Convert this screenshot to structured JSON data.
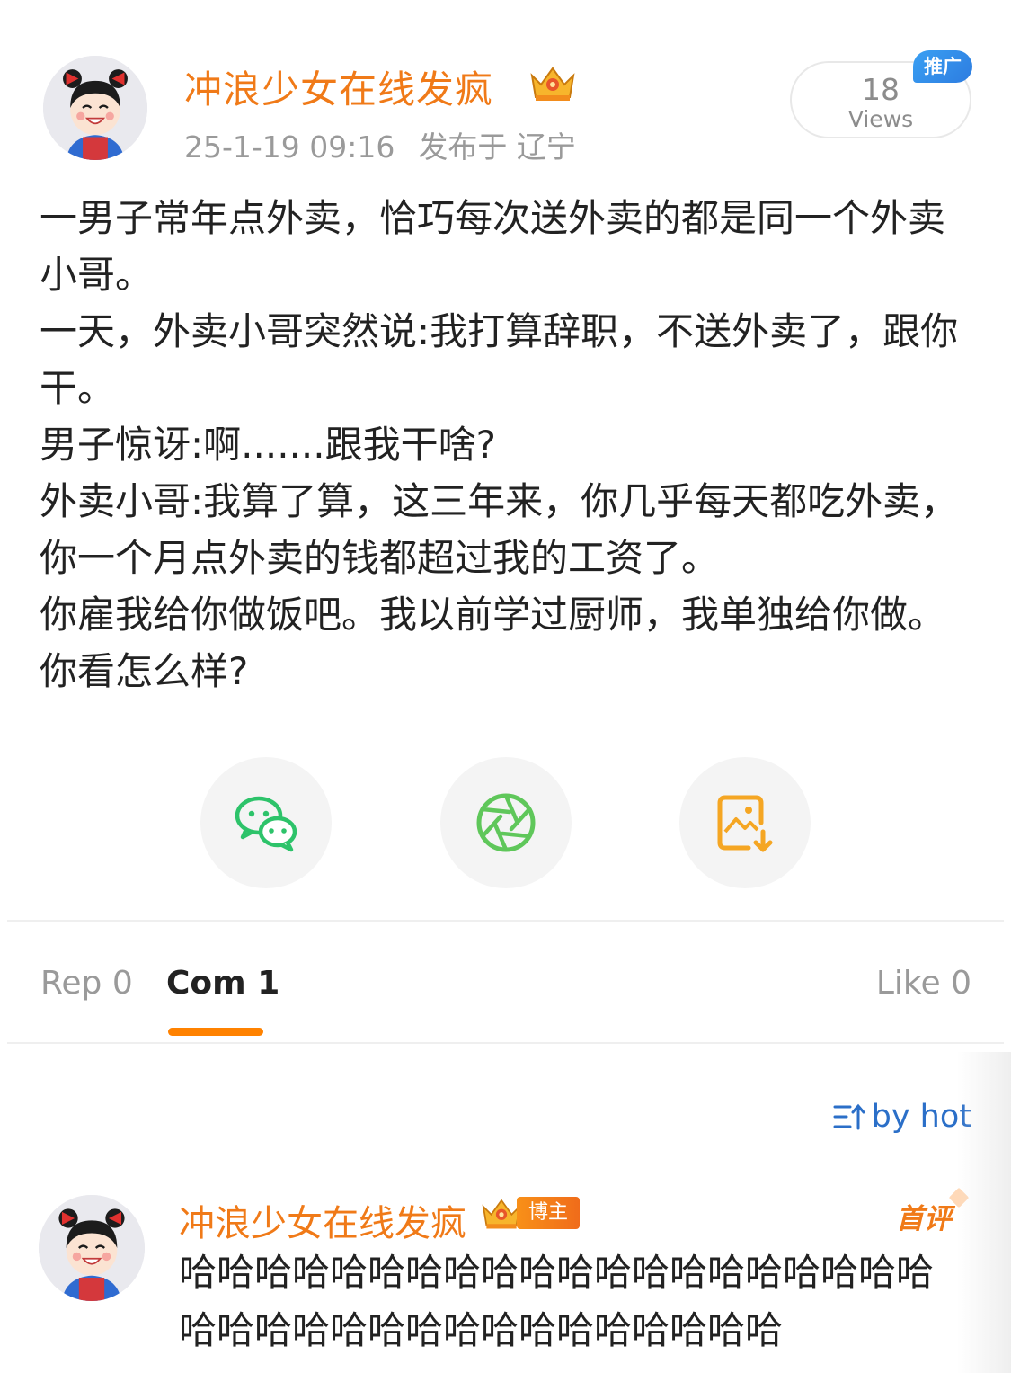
{
  "post": {
    "author": "冲浪少女在线发疯",
    "timestamp": "25-1-19 09:16",
    "location": "发布于 辽宁",
    "views_count": "18",
    "views_label": "Views",
    "promo_tag": "推广",
    "body_lines": [
      "一男子常年点外卖，恰巧每次送外卖的都是同一个外卖小哥。",
      "一天，外卖小哥突然说:我打算辞职，不送外卖了，跟你干。",
      "男子惊讶:啊.......跟我干啥?",
      "外卖小哥:我算了算，这三年来，你几乎每天都吃外卖，你一个月点外卖的钱都超过我的工资了。",
      "你雇我给你做饭吧。我以前学过厨师，我单独给你做。你看怎么样?"
    ]
  },
  "share": {
    "wechat_icon": "wechat-icon",
    "moments_icon": "moments-icon",
    "save_icon": "save-image-icon"
  },
  "tabs": {
    "rep": "Rep 0",
    "com": "Com 1",
    "like": "Like 0"
  },
  "sort_label": "by hot",
  "comment": {
    "author": "冲浪少女在线发疯",
    "badge": "博主",
    "first_tag": "首评",
    "text": "哈哈哈哈哈哈哈哈哈哈哈哈哈哈哈哈哈哈哈哈哈哈哈哈哈哈哈哈哈哈哈哈哈哈哈哈"
  },
  "colors": {
    "accent_orange": "#f07a18",
    "tab_indicator": "#ff8200",
    "link_blue": "#2b6fc8",
    "wechat_green": "#2dc36a",
    "moments_green": "#5fc75a",
    "save_orange": "#f5a623"
  }
}
